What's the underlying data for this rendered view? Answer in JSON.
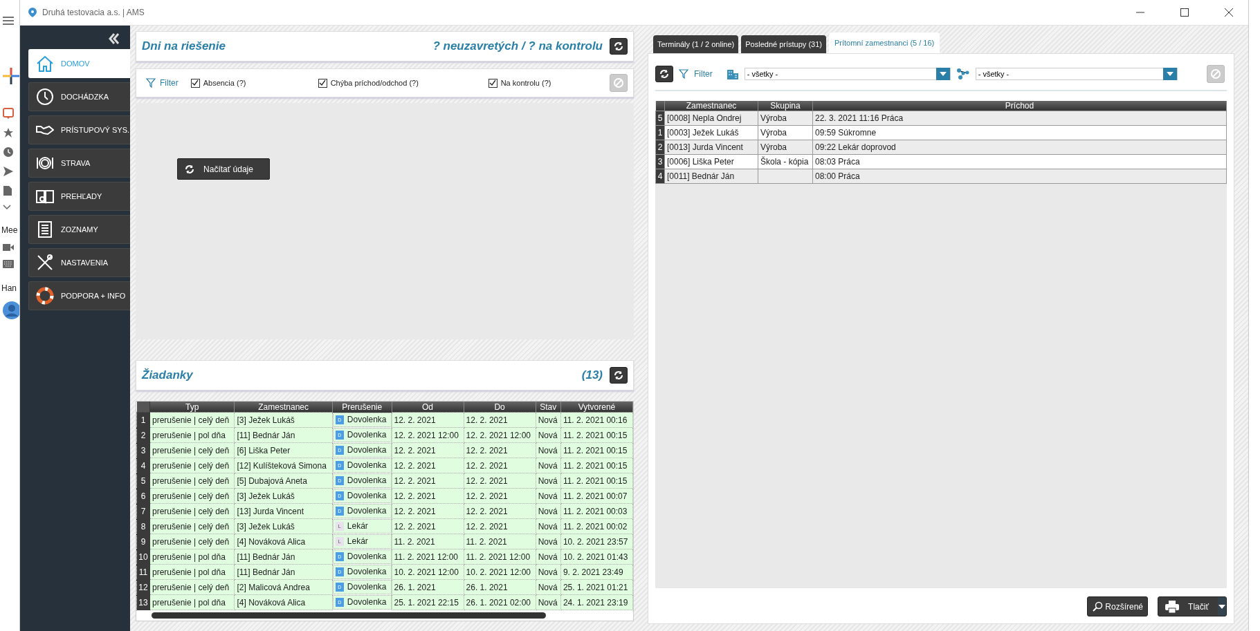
{
  "background_app": {
    "labels": [
      "Mee",
      "Han"
    ]
  },
  "window": {
    "title": "Druhá testovacia a.s. | AMS"
  },
  "sidebar": {
    "items": [
      {
        "label": "DOMOV",
        "selected": true,
        "kind": "home"
      },
      {
        "label": "DOCHÁDZKA",
        "selected": false,
        "kind": "clock"
      },
      {
        "label": "PRÍSTUPOVÝ SYS.",
        "selected": false,
        "kind": "hand"
      },
      {
        "label": "STRAVA",
        "selected": false,
        "kind": "plate"
      },
      {
        "label": "PREHĽADY",
        "selected": false,
        "kind": "book"
      },
      {
        "label": "ZOZNAMY",
        "selected": false,
        "kind": "list"
      },
      {
        "label": "NASTAVENIA",
        "selected": false,
        "kind": "tools"
      },
      {
        "label": "PODPORA + INFO",
        "selected": false,
        "kind": "buoy"
      }
    ]
  },
  "days_panel": {
    "title": "Dni na riešenie",
    "summary": "? neuzavretých / ? na kontrolu",
    "filter_label": "Filter",
    "checkboxes": [
      {
        "label": "Absencia (?)",
        "checked": true
      },
      {
        "label": "Chýba príchod/odchod (?)",
        "checked": true
      },
      {
        "label": "Na kontrolu (?)",
        "checked": true
      }
    ],
    "load_button": "Načítať údaje"
  },
  "requests_panel": {
    "title": "Žiadanky",
    "count": "(13)",
    "table": {
      "columns": [
        "Typ",
        "Zamestnanec",
        "Prerušenie",
        "Od",
        "Do",
        "Stav",
        "Vytvorené"
      ],
      "rows": [
        {
          "n": "1",
          "typ": "prerušenie | celý deň",
          "employee": "[3] Ježek Lukáš",
          "badge": "D",
          "color": "#4a9ee8",
          "absence": "Dovolenka",
          "od": "12. 2. 2021",
          "do": "12. 2. 2021",
          "stav": "Nová",
          "created": "11. 2. 2021  00:16"
        },
        {
          "n": "2",
          "typ": "prerušenie | pol dňa",
          "employee": "[11] Bednár Ján",
          "badge": "D",
          "color": "#4a9ee8",
          "absence": "Dovolenka",
          "od": "12. 2. 2021 12:00",
          "do": "12. 2. 2021 12:00",
          "stav": "Nová",
          "created": "11. 2. 2021  00:15"
        },
        {
          "n": "3",
          "typ": "prerušenie | celý deň",
          "employee": "[6] Liška Peter",
          "badge": "D",
          "color": "#4a9ee8",
          "absence": "Dovolenka",
          "od": "12. 2. 2021",
          "do": "12. 2. 2021",
          "stav": "Nová",
          "created": "11. 2. 2021  00:15"
        },
        {
          "n": "4",
          "typ": "prerušenie | celý deň",
          "employee": "[12] Kulíšteková Simona",
          "badge": "D",
          "color": "#4a9ee8",
          "absence": "Dovolenka",
          "od": "12. 2. 2021",
          "do": "12. 2. 2021",
          "stav": "Nová",
          "created": "11. 2. 2021  00:15"
        },
        {
          "n": "5",
          "typ": "prerušenie | celý deň",
          "employee": "[5] Dubajová Aneta",
          "badge": "D",
          "color": "#4a9ee8",
          "absence": "Dovolenka",
          "od": "12. 2. 2021",
          "do": "12. 2. 2021",
          "stav": "Nová",
          "created": "11. 2. 2021  00:15"
        },
        {
          "n": "6",
          "typ": "prerušenie | celý deň",
          "employee": "[3] Ježek Lukáš",
          "badge": "D",
          "color": "#4a9ee8",
          "absence": "Dovolenka",
          "od": "12. 2. 2021",
          "do": "12. 2. 2021",
          "stav": "Nová",
          "created": "11. 2. 2021  00:07"
        },
        {
          "n": "7",
          "typ": "prerušenie | celý deň",
          "employee": "[13] Jurda Vincent",
          "badge": "D",
          "color": "#4a9ee8",
          "absence": "Dovolenka",
          "od": "12. 2. 2021",
          "do": "12. 2. 2021",
          "stav": "Nová",
          "created": "11. 2. 2021  00:03"
        },
        {
          "n": "8",
          "typ": "prerušenie | celý deň",
          "employee": "[3] Ježek Lukáš",
          "badge": "L",
          "color": "#e8e0ec",
          "absence": "Lekár",
          "od": "12. 2. 2021",
          "do": "12. 2. 2021",
          "stav": "Nová",
          "created": "11. 2. 2021  00:02"
        },
        {
          "n": "9",
          "typ": "prerušenie | celý deň",
          "employee": "[4] Nováková Alica",
          "badge": "L",
          "color": "#e8e0ec",
          "absence": "Lekár",
          "od": "11. 2. 2021",
          "do": "11. 2. 2021",
          "stav": "Nová",
          "created": "10. 2. 2021  23:57"
        },
        {
          "n": "10",
          "typ": "prerušenie | pol dňa",
          "employee": "[11] Bednár Ján",
          "badge": "D",
          "color": "#4a9ee8",
          "absence": "Dovolenka",
          "od": "11. 2. 2021 12:00",
          "do": "11. 2. 2021 12:00",
          "stav": "Nová",
          "created": "10. 2. 2021  01:43"
        },
        {
          "n": "11",
          "typ": "prerušenie | pol dňa",
          "employee": "[11] Bednár Ján",
          "badge": "D",
          "color": "#4a9ee8",
          "absence": "Dovolenka",
          "od": "10. 2. 2021 12:00",
          "do": "10. 2. 2021 12:00",
          "stav": "Nová",
          "created": "9. 2. 2021  23:49"
        },
        {
          "n": "12",
          "typ": "prerušenie | celý deň",
          "employee": "[2] Malicová Andrea",
          "badge": "D",
          "color": "#4a9ee8",
          "absence": "Dovolenka",
          "od": "26. 1. 2021",
          "do": "26. 1. 2021",
          "stav": "Nová",
          "created": "25. 1. 2021  01:21"
        },
        {
          "n": "13",
          "typ": "prerušenie | pol dňa",
          "employee": "[4] Nováková Alica",
          "badge": "D",
          "color": "#4a9ee8",
          "absence": "Dovolenka",
          "od": "25. 1. 2021 22:15",
          "do": "26. 1. 2021 02:00",
          "stav": "Nová",
          "created": "24. 1. 2021  23:19"
        }
      ]
    }
  },
  "right_panel": {
    "tabs": [
      {
        "label": "Terminály (1 / 2 online)",
        "selected": false
      },
      {
        "label": "Posledné prístupy (31)",
        "selected": false
      },
      {
        "label": "Prítomní zamestnanci (5 / 16)",
        "selected": true
      }
    ],
    "filter_label": "Filter",
    "building_select": "- všetky -",
    "group_select": "- všetky -",
    "table": {
      "columns": [
        "Zamestnanec",
        "Skupina",
        "Príchod"
      ],
      "rows": [
        {
          "n": "5",
          "employee": "[0008] Nepla Ondrej",
          "group": "Výroba",
          "arrival": "22. 3. 2021 11:16 Práca"
        },
        {
          "n": "1",
          "employee": "[0003] Ježek Lukáš",
          "group": "Výroba",
          "arrival": "09:59 Súkromne"
        },
        {
          "n": "2",
          "employee": "[0013] Jurda Vincent",
          "group": "Výroba",
          "arrival": "09:22 Lekár doprovod"
        },
        {
          "n": "3",
          "employee": "[0006] Liška Peter",
          "group": "Škola - kópia",
          "arrival": "08:03 Práca"
        },
        {
          "n": "4",
          "employee": "[0011] Bednár Ján",
          "group": "",
          "arrival": "08:00 Práca"
        }
      ]
    },
    "buttons": {
      "advanced": "Rozšírené",
      "print": "Tlačiť"
    }
  }
}
